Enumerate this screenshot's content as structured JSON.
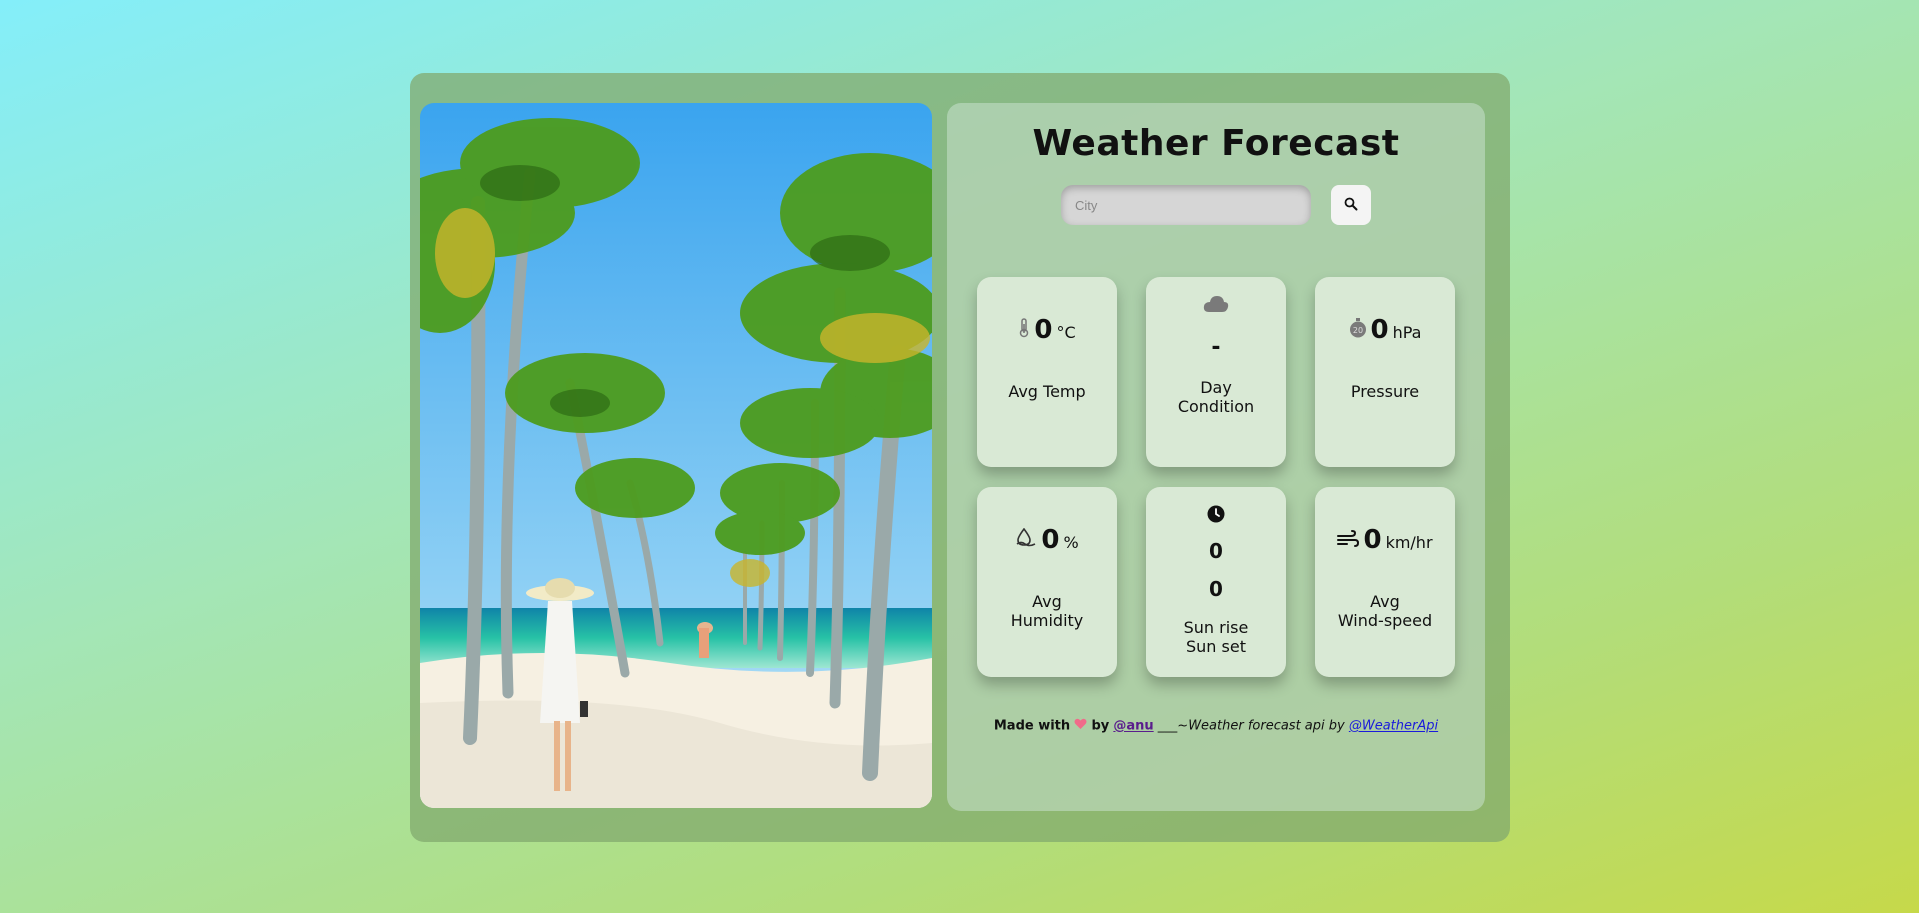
{
  "app": {
    "title": "Weather Forecast",
    "search": {
      "placeholder": "City",
      "value": ""
    },
    "search_button_icon": "search-icon",
    "accent": "#d9e9d5"
  },
  "cards": {
    "avg_temp": {
      "icon": "thermometer-icon",
      "value": "0",
      "unit": "°C",
      "label": "Avg Temp"
    },
    "day_condition": {
      "icon": "cloud-icon",
      "value": "-",
      "label_line1": "Day",
      "label_line2": "Condition"
    },
    "pressure": {
      "icon": "gauge-icon",
      "value": "0",
      "unit": "hPa",
      "label": "Pressure"
    },
    "avg_humidity": {
      "icon": "humidity-icon",
      "value": "0",
      "unit": "%",
      "label_line1": "Avg",
      "label_line2": "Humidity"
    },
    "sun": {
      "icon": "clock-icon",
      "sunrise": "0",
      "sunset": "0",
      "label_line1": "Sun rise",
      "label_line2": "Sun set"
    },
    "wind": {
      "icon": "wind-icon",
      "value": "0",
      "unit": "km/hr",
      "label_line1": "Avg",
      "label_line2": "Wind-speed"
    }
  },
  "footer": {
    "made_with": "Made with",
    "heart_icon": "heart-icon",
    "by": "by",
    "author": "@anu",
    "separator": " ___~",
    "api_text": "Weather forecast api by ",
    "api_link": "@WeatherApi"
  }
}
